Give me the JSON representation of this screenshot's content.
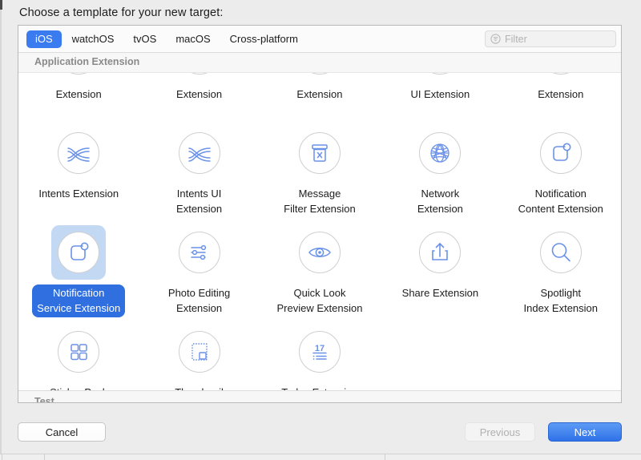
{
  "sheet": {
    "title": "Choose a template for your new target:"
  },
  "platform_tabs": [
    {
      "label": "iOS",
      "active": true
    },
    {
      "label": "watchOS",
      "active": false
    },
    {
      "label": "tvOS",
      "active": false
    },
    {
      "label": "macOS",
      "active": false
    },
    {
      "label": "Cross-platform",
      "active": false
    }
  ],
  "filter": {
    "placeholder": "Filter",
    "value": "",
    "icon": "filter-icon"
  },
  "sections": {
    "current": "Application Extension",
    "next_partial": "Test"
  },
  "colors": {
    "accent": "#3a7bf0",
    "selection_pill": "#2f6fe0",
    "selection_icon_bg": "#c3d8f3",
    "icon_stroke": "#6a92e8",
    "panel_bg": "#ffffff",
    "window_bg": "#ececec",
    "section_header_text": "#8a8a8a"
  },
  "templates": [
    {
      "label": "Extension",
      "icon": "clipped-icon",
      "selected": false,
      "clipped": true
    },
    {
      "label": "Extension",
      "icon": "clipped-icon",
      "selected": false,
      "clipped": true
    },
    {
      "label": "Extension",
      "icon": "clipped-icon",
      "selected": false,
      "clipped": true
    },
    {
      "label": "UI Extension",
      "icon": "clipped-icon",
      "selected": false,
      "clipped": true
    },
    {
      "label": "Extension",
      "icon": "clipped-icon",
      "selected": false,
      "clipped": true
    },
    {
      "label": "Intents Extension",
      "icon": "intents-icon",
      "selected": false
    },
    {
      "label": "Intents UI\nExtension",
      "icon": "intents-ui-icon",
      "selected": false
    },
    {
      "label": "Message\nFilter Extension",
      "icon": "message-filter-icon",
      "selected": false
    },
    {
      "label": "Network\nExtension",
      "icon": "globe-icon",
      "selected": false
    },
    {
      "label": "Notification\nContent Extension",
      "icon": "notification-badge-icon",
      "selected": false
    },
    {
      "label": "Notification\nService Extension",
      "icon": "notification-badge-icon",
      "selected": true
    },
    {
      "label": "Photo Editing\nExtension",
      "icon": "sliders-icon",
      "selected": false
    },
    {
      "label": "Quick Look\nPreview Extension",
      "icon": "eye-icon",
      "selected": false
    },
    {
      "label": "Share Extension",
      "icon": "share-icon",
      "selected": false
    },
    {
      "label": "Spotlight\nIndex Extension",
      "icon": "magnifier-icon",
      "selected": false
    },
    {
      "label": "Sticker Pack\nExtension",
      "icon": "grid-squares-icon",
      "selected": false
    },
    {
      "label": "Thumbnail\nExtension",
      "icon": "thumbnail-icon",
      "selected": false
    },
    {
      "label": "Today Extension",
      "icon": "calendar-17-icon",
      "selected": false
    }
  ],
  "buttons": {
    "cancel": "Cancel",
    "previous": "Previous",
    "next": "Next"
  }
}
